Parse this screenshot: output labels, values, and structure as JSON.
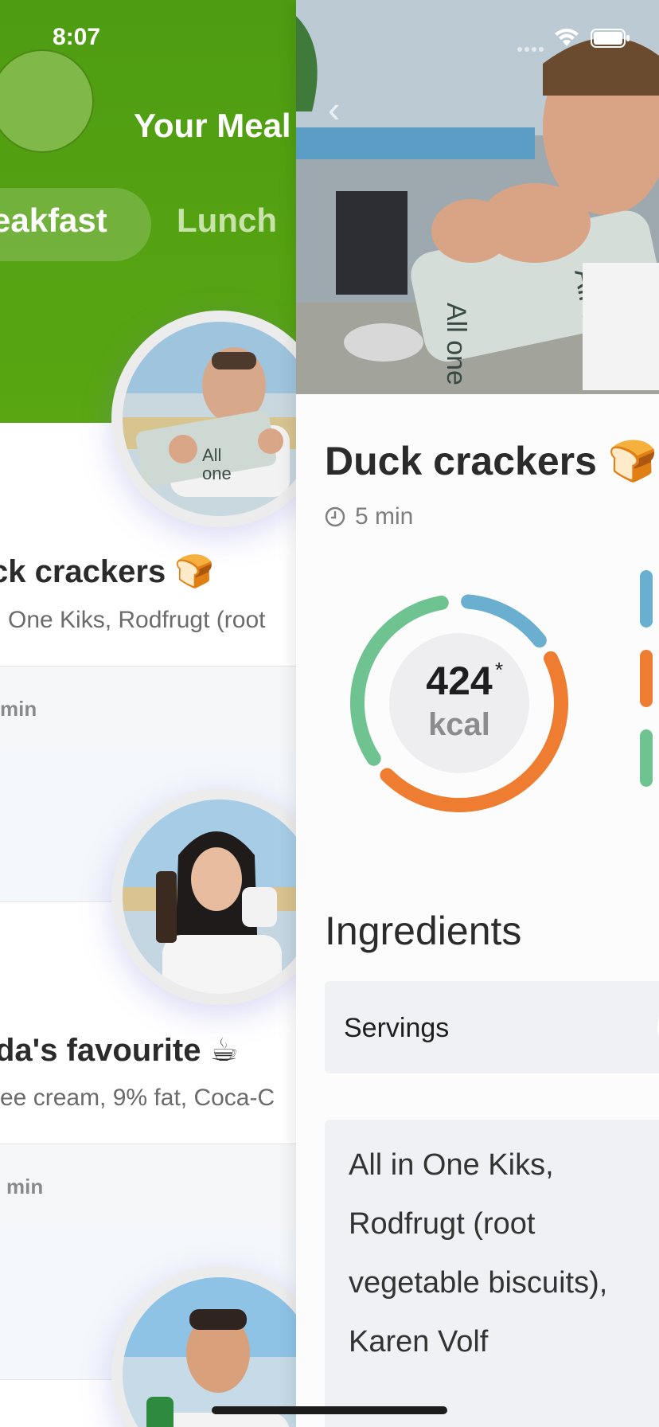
{
  "status_bar": {
    "time": "8:07"
  },
  "meals_screen": {
    "title": "Your Meal",
    "tabs": [
      {
        "label": "eakfast",
        "selected": true
      },
      {
        "label": "Lunch",
        "selected": false
      }
    ],
    "meals": [
      {
        "title": "ck crackers",
        "emoji": "🍞",
        "ingredients": "One Kiks, Rodfrugt (root",
        "time": "min"
      },
      {
        "title": "da's favourite",
        "emoji": "☕",
        "ingredients": "ee cream, 9% fat, Coca-C",
        "time": "min"
      }
    ]
  },
  "recipe": {
    "title": "Duck crackers",
    "emoji": "🍞",
    "time": "5 min",
    "kcal_value": "424",
    "kcal_asterisk": "*",
    "kcal_unit": "kcal",
    "ingredients_heading": "Ingredients",
    "servings_label": "Servings",
    "ingredients_text": "All in One Kiks, Rodfrugt (root vegetable biscuits), Karen Volf"
  },
  "colors": {
    "brand_green": "#55a312",
    "macro_blue": "#6aaed0",
    "macro_orange": "#ee7d31",
    "macro_green": "#6ec391"
  },
  "icons": [
    "back-chevron-icon",
    "wifi-icon",
    "battery-icon",
    "clock-icon",
    "bread-emoji-icon",
    "coffee-emoji-icon"
  ]
}
